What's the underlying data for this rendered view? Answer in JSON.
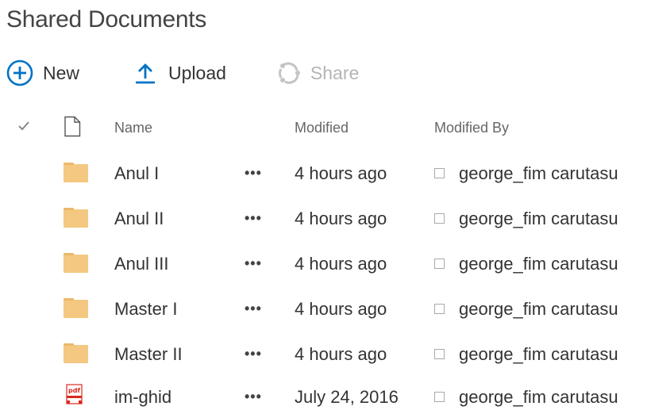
{
  "page": {
    "title": "Shared Documents"
  },
  "toolbar": {
    "new_label": "New",
    "upload_label": "Upload",
    "share_label": "Share"
  },
  "columns": {
    "name": "Name",
    "modified": "Modified",
    "modified_by": "Modified By"
  },
  "rows": [
    {
      "type": "folder",
      "name": "Anul I",
      "modified": "4 hours ago",
      "modified_by": "george_fim carutasu"
    },
    {
      "type": "folder",
      "name": "Anul II",
      "modified": "4 hours ago",
      "modified_by": "george_fim carutasu"
    },
    {
      "type": "folder",
      "name": "Anul III",
      "modified": "4 hours ago",
      "modified_by": "george_fim carutasu"
    },
    {
      "type": "folder",
      "name": "Master I",
      "modified": "4 hours ago",
      "modified_by": "george_fim carutasu"
    },
    {
      "type": "folder",
      "name": "Master II",
      "modified": "4 hours ago",
      "modified_by": "george_fim carutasu"
    },
    {
      "type": "pdf",
      "name": "im-ghid",
      "modified": "July 24, 2016",
      "modified_by": "george_fim carutasu"
    }
  ],
  "icons": {
    "new": "plus-circle-icon",
    "upload": "upload-arrow-icon",
    "share": "share-icon",
    "select_all": "checkmark-icon",
    "type_header": "document-icon",
    "folder": "folder-icon",
    "pdf": "pdf-icon",
    "more": "ellipsis-icon"
  },
  "colors": {
    "accent": "#0072c6",
    "folder": "#f4c881",
    "pdf": "#d9281e",
    "disabled": "#b5b5b5"
  }
}
